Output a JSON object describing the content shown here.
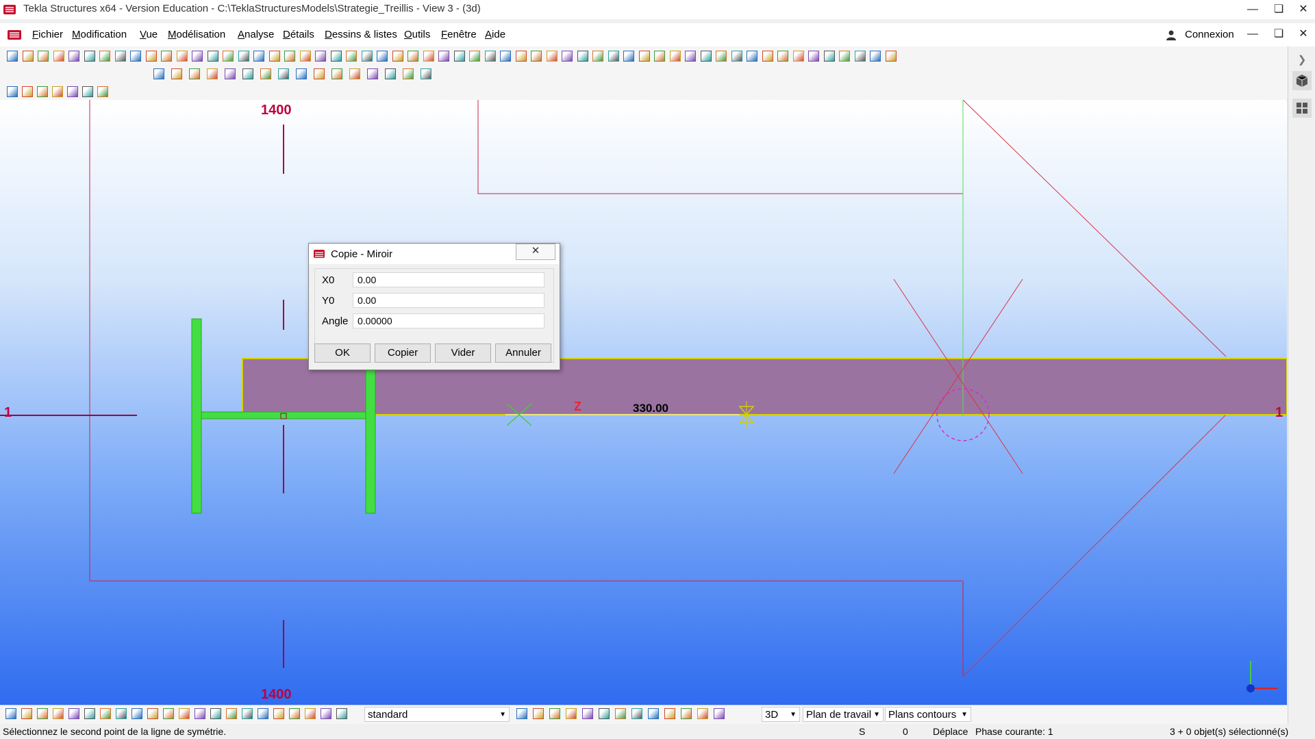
{
  "window": {
    "title": "Tekla Structures x64 - Version Education - C:\\TeklaStructuresModels\\Strategie_Treillis  - View 3 - (3d)",
    "controls": [
      "minimize",
      "maximize",
      "close"
    ]
  },
  "menu": {
    "items": [
      {
        "acc": "F",
        "rest": "ichier"
      },
      {
        "acc": "M",
        "rest": "odification"
      },
      {
        "acc": "V",
        "rest": "ue"
      },
      {
        "acc": "M",
        "rest": "odélisation"
      },
      {
        "acc": "A",
        "rest": "nalyse"
      },
      {
        "acc": "D",
        "rest": "étails"
      },
      {
        "acc": "D",
        "rest": "essins & listes"
      },
      {
        "acc": "O",
        "rest": "utils"
      },
      {
        "acc": "F",
        "rest": "enêtre"
      },
      {
        "acc": "A",
        "rest": "ide"
      }
    ],
    "connexion": "Connexion"
  },
  "viewport": {
    "grid_labels": {
      "top": "1400",
      "bottom": "1400",
      "left": "1",
      "right": "1"
    },
    "dimension": "330.00",
    "axis_label": "Z",
    "colors": {
      "grid": "#a0003c",
      "beam_fill": "#9a73a0",
      "beam_edge": "#d4d000",
      "column": "#44dd44",
      "construction": "#e03030",
      "guide": "#55dd55"
    }
  },
  "dialog": {
    "title": "Copie - Miroir",
    "close_icon": "close-icon",
    "fields": [
      {
        "label": "X0",
        "value": "0.00"
      },
      {
        "label": "Y0",
        "value": "0.00"
      },
      {
        "label": "Angle",
        "value": "0.00000"
      }
    ],
    "buttons": {
      "ok": "OK",
      "copy": "Copier",
      "clear": "Vider",
      "cancel": "Annuler"
    }
  },
  "bottom_toolbar": {
    "selection_filter": "standard",
    "view_mode": "3D",
    "work_plane": "Plan de travail",
    "contour_planes": "Plans contours"
  },
  "status": {
    "prompt": "Sélectionnez le second point de la ligne de symétrie.",
    "snap": "S",
    "count": "0",
    "mode": "Déplace",
    "phase": "Phase courante: 1",
    "selection": "3 + 0 objet(s) sélectionné(s)"
  }
}
